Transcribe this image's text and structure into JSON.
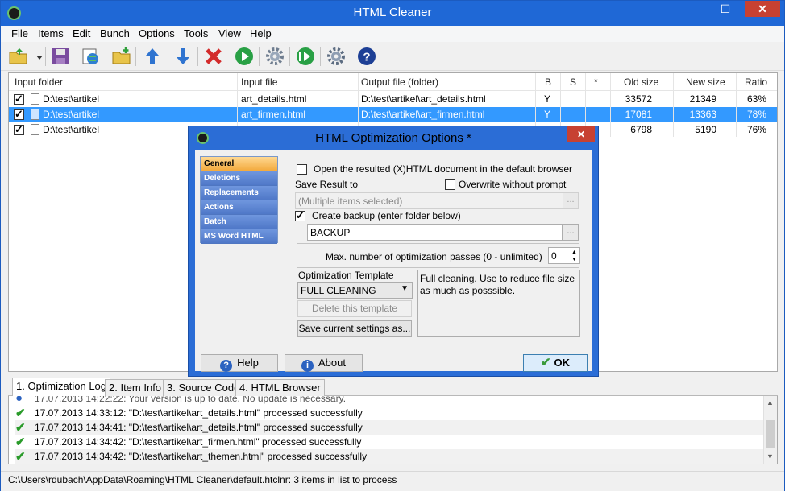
{
  "window": {
    "title": "HTML Cleaner"
  },
  "menu": [
    "File",
    "Items",
    "Edit",
    "Bunch",
    "Options",
    "Tools",
    "View",
    "Help"
  ],
  "toolbar": {
    "buttons": [
      "open-folder",
      "save",
      "add-web",
      "add-folder",
      "move-up",
      "move-down",
      "remove",
      "run",
      "settings",
      "run-all",
      "bunch-settings",
      "help"
    ]
  },
  "list": {
    "columns": [
      "Input folder",
      "Input file",
      "Output file (folder)",
      "B",
      "S",
      "*",
      "Old size",
      "New size",
      "Ratio"
    ],
    "rows": [
      {
        "folder": "D:\\test\\artikel",
        "file": "art_details.html",
        "output": "D:\\test\\artikel\\art_details.html",
        "b": "Y",
        "s": "",
        "star": "",
        "old": "33572",
        "new": "21349",
        "ratio": "63%"
      },
      {
        "folder": "D:\\test\\artikel",
        "file": "art_firmen.html",
        "output": "D:\\test\\artikel\\art_firmen.html",
        "b": "Y",
        "s": "",
        "star": "",
        "old": "17081",
        "new": "13363",
        "ratio": "78%"
      },
      {
        "folder": "D:\\test\\artikel",
        "file": "",
        "output": "",
        "b": "",
        "s": "",
        "star": "",
        "old": "6798",
        "new": "5190",
        "ratio": "76%"
      }
    ]
  },
  "tabs": [
    "1. Optimization Log",
    "2. Item Info",
    "3. Source Code",
    "4. HTML Browser"
  ],
  "log": [
    "17.07.2013 14:22:22: Your version is up to date. No update is necessary.",
    "17.07.2013 14:33:12: \"D:\\test\\artikel\\art_details.html\" processed successfully",
    "17.07.2013 14:34:41: \"D:\\test\\artikel\\art_details.html\" processed successfully",
    "17.07.2013 14:34:42: \"D:\\test\\artikel\\art_firmen.html\" processed successfully",
    "17.07.2013 14:34:42: \"D:\\test\\artikel\\art_themen.html\" processed successfully"
  ],
  "status": "C:\\Users\\rdubach\\AppData\\Roaming\\HTML Cleaner\\default.htclnr: 3 items in list to process",
  "dialog": {
    "title": "HTML Optimization Options *",
    "nav": [
      "General",
      "Deletions",
      "Replacements",
      "Actions",
      "Batch",
      "MS Word HTML"
    ],
    "open_browser_label": "Open the resulted (X)HTML document in the default browser",
    "save_result_label": "Save Result to",
    "overwrite_label": "Overwrite without prompt",
    "save_result_value": "(Multiple items selected)",
    "create_backup_label": "Create backup (enter folder below)",
    "backup_value": "BACKUP",
    "browse_label": "...",
    "passes_label": "Max. number of optimization passes (0 - unlimited)",
    "passes_value": "0",
    "template_label": "Optimization Template",
    "template_value": "FULL CLEANING",
    "template_desc": "Full cleaning. Use to reduce file size as much as posssible.",
    "delete_template_label": "Delete this template",
    "save_settings_label": "Save current settings as...",
    "help_label": "Help",
    "about_label": "About",
    "ok_label": "OK"
  }
}
